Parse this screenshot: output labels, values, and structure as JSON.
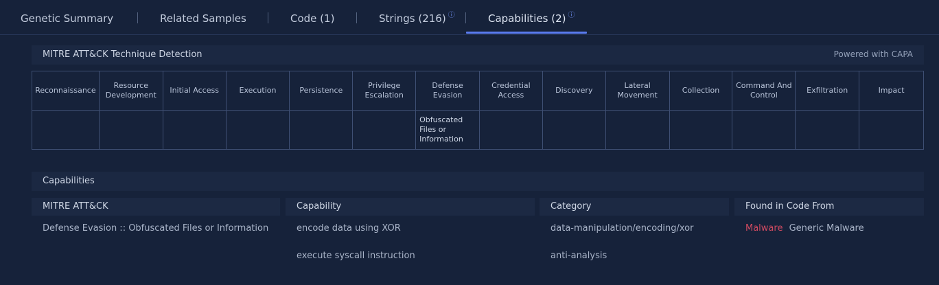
{
  "tabs": [
    {
      "label": "Genetic Summary"
    },
    {
      "label": "Related Samples"
    },
    {
      "label": "Code (1)"
    },
    {
      "label": "Strings (216)",
      "info": "ⓘ"
    },
    {
      "label": "Capabilities (2)",
      "info": "ⓘ",
      "active": true
    }
  ],
  "mitre_panel": {
    "title": "MITRE ATT&CK Technique Detection",
    "powered": "Powered with CAPA",
    "tactics": [
      "Reconnaissance",
      "Resource Development",
      "Initial Access",
      "Execution",
      "Persistence",
      "Privilege Escalation",
      "Defense Evasion",
      "Credential Access",
      "Discovery",
      "Lateral Movement",
      "Collection",
      "Command And Control",
      "Exfiltration",
      "Impact"
    ],
    "techniques": [
      "",
      "",
      "",
      "",
      "",
      "",
      "Obfuscated Files or Information",
      "",
      "",
      "",
      "",
      "",
      "",
      ""
    ]
  },
  "capabilities_panel": {
    "title": "Capabilities",
    "columns": [
      "MITRE ATT&CK",
      "Capability",
      "Category",
      "Found in Code From"
    ],
    "rows": [
      {
        "mitre": "Defense Evasion :: Obfuscated Files or Information",
        "capability": "encode data using XOR",
        "category": "data-manipulation/encoding/xor",
        "found_tag": "Malware",
        "found_text": "Generic Malware"
      },
      {
        "mitre": "",
        "capability": "execute syscall instruction",
        "category": "anti-analysis",
        "found_tag": "",
        "found_text": ""
      }
    ]
  },
  "colors": {
    "background": "#16223a",
    "accent": "#5a7cf0",
    "malware": "#d04a61"
  }
}
